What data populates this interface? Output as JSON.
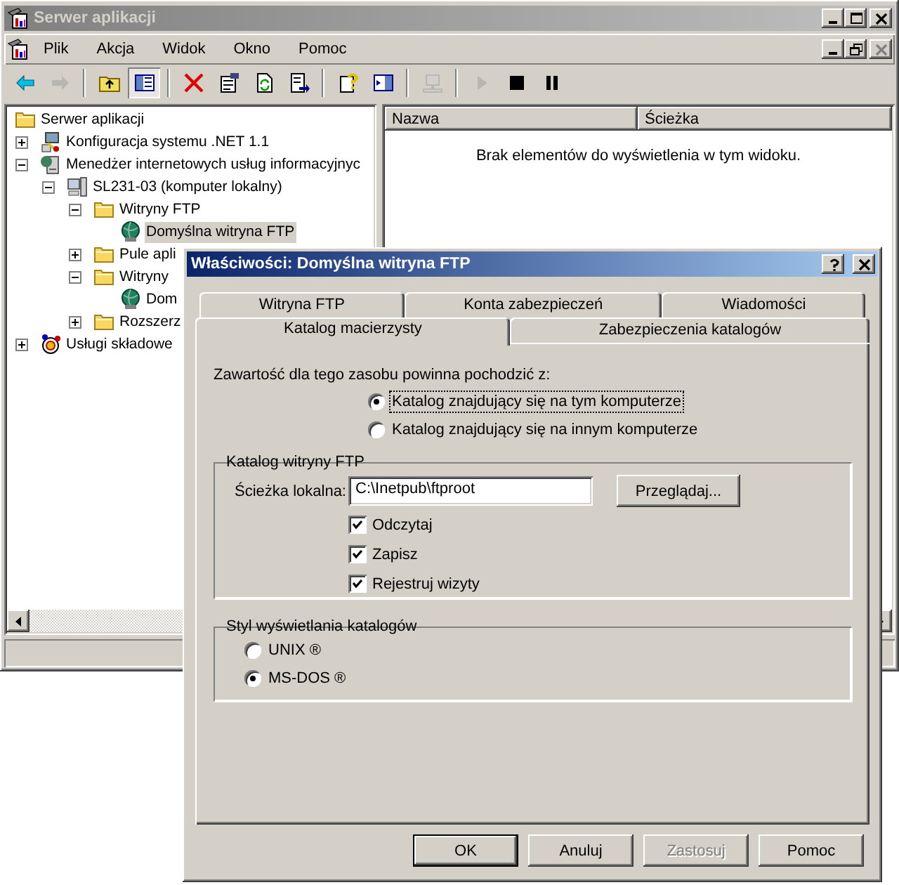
{
  "main_window": {
    "title": "Serwer aplikacji",
    "active": false
  },
  "menu": [
    "Plik",
    "Akcja",
    "Widok",
    "Okno",
    "Pomoc"
  ],
  "toolbar": [
    [
      {
        "kind": "back",
        "disabled": false,
        "pressed": false
      },
      {
        "kind": "forward",
        "disabled": true,
        "pressed": false
      }
    ],
    [
      {
        "kind": "up-folder",
        "disabled": false,
        "pressed": false
      },
      {
        "kind": "tree-toggle",
        "disabled": false,
        "pressed": true
      }
    ],
    [
      {
        "kind": "delete",
        "disabled": false,
        "pressed": false
      },
      {
        "kind": "properties",
        "disabled": false,
        "pressed": false
      },
      {
        "kind": "refresh",
        "disabled": false,
        "pressed": false
      },
      {
        "kind": "export",
        "disabled": false,
        "pressed": false
      }
    ],
    [
      {
        "kind": "help",
        "disabled": false,
        "pressed": false
      },
      {
        "kind": "action-pane",
        "disabled": false,
        "pressed": false
      }
    ],
    [
      {
        "kind": "computer",
        "disabled": true,
        "pressed": false
      }
    ],
    [
      {
        "kind": "play",
        "disabled": true,
        "pressed": false
      },
      {
        "kind": "stop",
        "disabled": false,
        "pressed": false
      },
      {
        "kind": "pause",
        "disabled": false,
        "pressed": false
      }
    ]
  ],
  "tree": [
    {
      "label": "Serwer aplikacji",
      "kind": "folder",
      "selected": false,
      "children": [
        {
          "label": "Konfiguracja systemu .NET 1.1",
          "kind": "net-config",
          "selected": false,
          "expanded": false
        },
        {
          "label": "Menedżer internetowych usług informacyjnyc",
          "kind": "iis",
          "selected": false,
          "expanded": true,
          "children": [
            {
              "label": "SL231-03 (komputer lokalny)",
              "kind": "computer",
              "selected": false,
              "expanded": true,
              "children": [
                {
                  "label": "Witryny FTP",
                  "kind": "folder",
                  "selected": false,
                  "expanded": true,
                  "children": [
                    {
                      "label": "Domyślna witryna FTP",
                      "kind": "site",
                      "selected": true
                    }
                  ]
                },
                {
                  "label": "Pule apli",
                  "kind": "folder",
                  "selected": false,
                  "expanded": false
                },
                {
                  "label": "Witryny",
                  "kind": "folder",
                  "selected": false,
                  "expanded": true,
                  "children": [
                    {
                      "label": "Dom",
                      "kind": "site",
                      "selected": false
                    }
                  ]
                },
                {
                  "label": "Rozszerz",
                  "kind": "folder",
                  "selected": false,
                  "expanded": false
                }
              ]
            }
          ]
        },
        {
          "label": "Usługi składowe",
          "kind": "components",
          "selected": false,
          "expanded": false
        }
      ]
    }
  ],
  "list": {
    "columns": [
      "Nazwa",
      "Ścieżka"
    ],
    "empty_message": "Brak elementów do wyświetlenia w tym widoku."
  },
  "dialog": {
    "title": "Właściwości: Domyślna witryna FTP",
    "active": true,
    "tab_rows": [
      [
        {
          "label": "Witryna FTP",
          "selected": false
        },
        {
          "label": "Konta zabezpieczeń",
          "selected": false
        },
        {
          "label": "Wiadomości",
          "selected": false
        }
      ],
      [
        {
          "label": "Katalog macierzysty",
          "selected": true
        },
        {
          "label": "Zabezpieczenia katalogów",
          "selected": false
        }
      ]
    ],
    "source_prompt": "Zawartość dla tego zasobu powinna pochodzić z:",
    "source_options": [
      {
        "label": "Katalog znajdujący się na tym komputerze",
        "selected": true,
        "focused": true
      },
      {
        "label": "Katalog znajdujący się na innym komputerze",
        "selected": false,
        "focused": false
      }
    ],
    "path_group": {
      "title": "Katalog witryny FTP",
      "path_label": "Ścieżka lokalna:",
      "path_value": "C:\\Inetpub\\ftproot",
      "browse_button": "Przeglądaj...",
      "permissions": [
        {
          "label": "Odczytaj",
          "checked": true
        },
        {
          "label": "Zapisz",
          "checked": true
        },
        {
          "label": "Rejestruj wizyty",
          "checked": true
        }
      ]
    },
    "style_group": {
      "title": "Styl wyświetlania katalogów",
      "options": [
        {
          "label": "UNIX ®",
          "selected": false
        },
        {
          "label": "MS-DOS ®",
          "selected": true
        }
      ]
    },
    "buttons": [
      {
        "label": "OK",
        "default": true,
        "disabled": false
      },
      {
        "label": "Anuluj",
        "default": false,
        "disabled": false
      },
      {
        "label": "Zastosuj",
        "default": false,
        "disabled": true
      },
      {
        "label": "Pomoc",
        "default": false,
        "disabled": false
      }
    ]
  }
}
